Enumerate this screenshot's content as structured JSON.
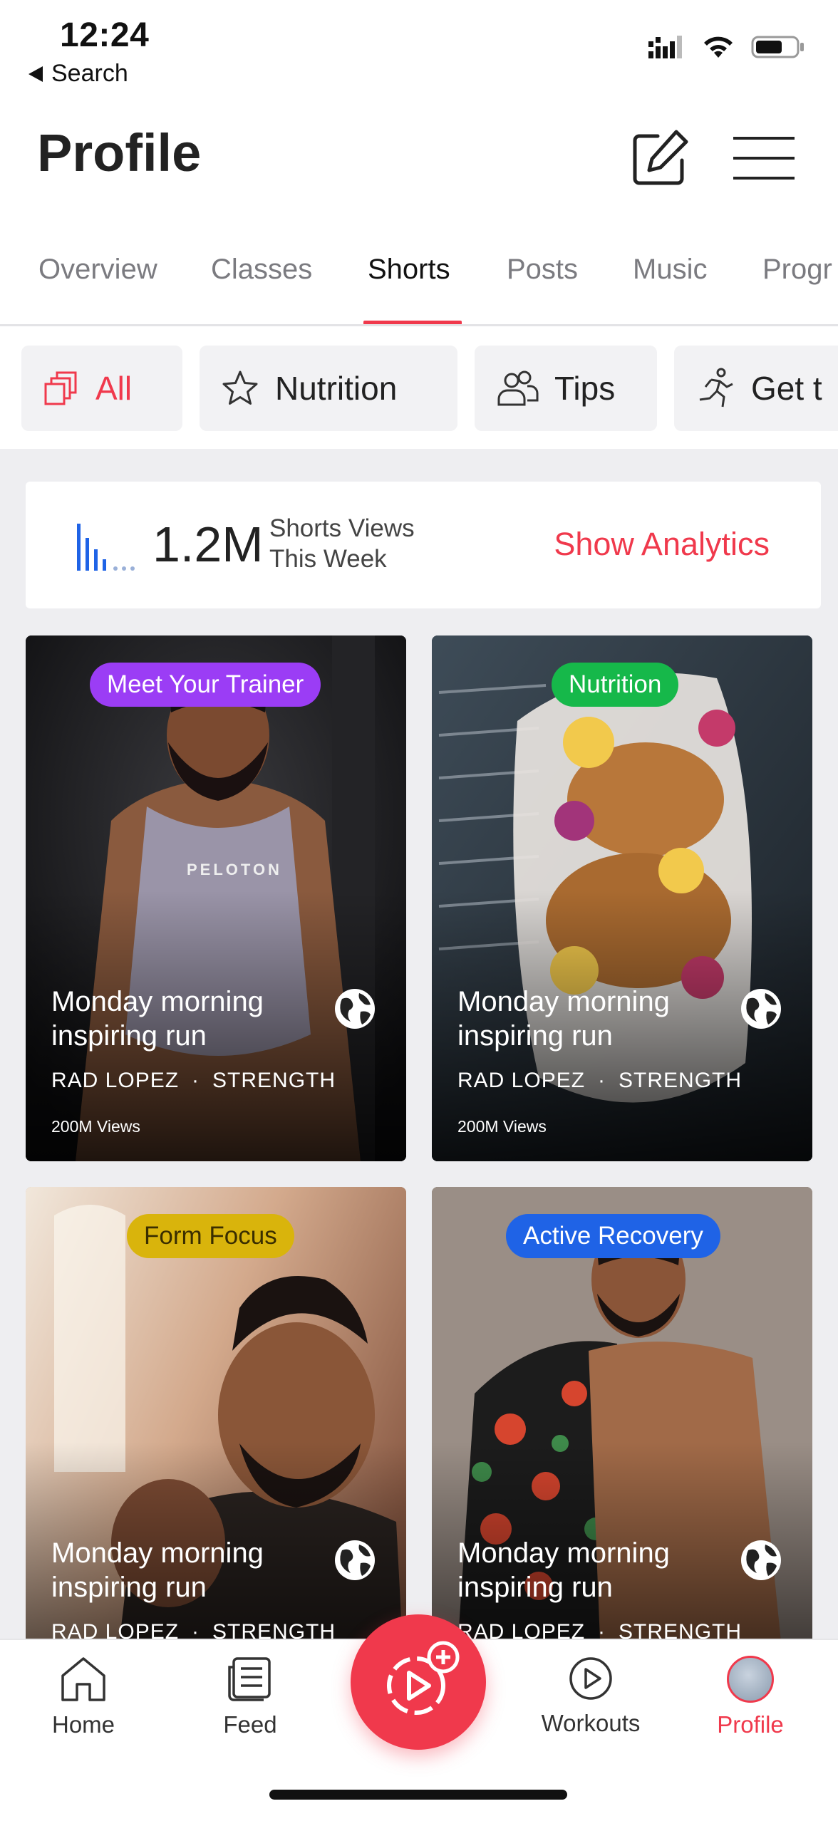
{
  "status_bar": {
    "time": "12:24",
    "back_label": "Search"
  },
  "header": {
    "title": "Profile",
    "edit_icon": "edit-icon",
    "menu_icon": "menu-icon"
  },
  "tabs": [
    {
      "label": "Overview"
    },
    {
      "label": "Classes"
    },
    {
      "label": "Shorts",
      "active": true
    },
    {
      "label": "Posts"
    },
    {
      "label": "Music"
    },
    {
      "label": "Progr"
    }
  ],
  "filters": [
    {
      "label": "All",
      "icon": "stack-icon",
      "active": true
    },
    {
      "label": "Nutrition",
      "icon": "star-icon"
    },
    {
      "label": "Tips",
      "icon": "people-icon"
    },
    {
      "label": "Get t",
      "icon": "runner-icon"
    }
  ],
  "analytics": {
    "value": "1.2M",
    "label_line1": "Shorts Views",
    "label_line2": "This Week",
    "link": "Show Analytics"
  },
  "cards": [
    {
      "tag": "Meet Your Trainer",
      "tag_color": "#9b3df5",
      "title": "Monday morning inspiring run",
      "instructor": "RAD LOPEZ",
      "category": "STRENGTH",
      "views": "200M Views",
      "shirt_text": "PELOTON"
    },
    {
      "tag": "Nutrition",
      "tag_color": "#16b84a",
      "title": "Monday morning inspiring run",
      "instructor": "RAD LOPEZ",
      "category": "STRENGTH",
      "views": "200M Views"
    },
    {
      "tag": "Form Focus",
      "tag_color": "#d9b40c",
      "tag_text_color": "#3a2e00",
      "title": "Monday morning inspiring run",
      "instructor": "RAD LOPEZ",
      "category": "STRENGTH"
    },
    {
      "tag": "Active Recovery",
      "tag_color": "#1f63e6",
      "title": "Monday morning inspiring run",
      "instructor": "RAD LOPEZ",
      "category": "STRENGTH"
    }
  ],
  "bottom_nav": [
    {
      "label": "Home",
      "icon": "home-icon"
    },
    {
      "label": "Feed",
      "icon": "feed-icon"
    },
    {
      "label": "Workouts",
      "icon": "play-circle-icon"
    },
    {
      "label": "Profile",
      "icon": "avatar",
      "active": true
    }
  ],
  "colors": {
    "accent": "#f0394c",
    "background": "#eeeef1"
  }
}
